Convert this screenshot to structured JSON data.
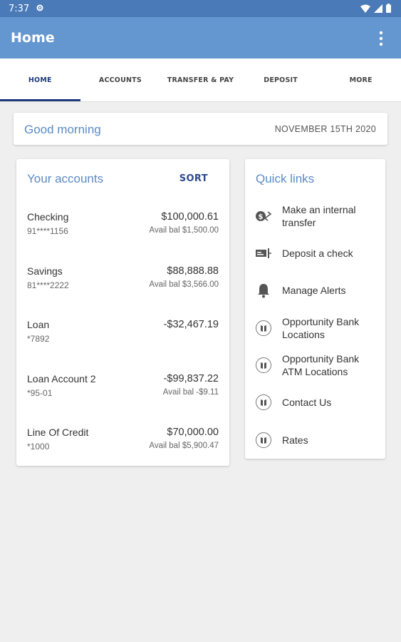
{
  "status_bar": {
    "time": "7:37"
  },
  "app_bar": {
    "title": "Home"
  },
  "tabs": [
    {
      "label": "HOME",
      "active": true
    },
    {
      "label": "ACCOUNTS",
      "active": false
    },
    {
      "label": "TRANSFER & PAY",
      "active": false
    },
    {
      "label": "DEPOSIT",
      "active": false
    },
    {
      "label": "MORE",
      "active": false
    }
  ],
  "greeting": {
    "text": "Good morning",
    "date": "NOVEMBER 15TH 2020"
  },
  "accounts": {
    "title": "Your accounts",
    "sort_label": "SORT",
    "items": [
      {
        "name": "Checking",
        "number": "91****1156",
        "balance": "$100,000.61",
        "avail": "Avail bal $1,500.00"
      },
      {
        "name": "Savings",
        "number": "81****2222",
        "balance": "$88,888.88",
        "avail": "Avail bal $3,566.00"
      },
      {
        "name": "Loan",
        "number": "*7892",
        "balance": "-$32,467.19",
        "avail": ""
      },
      {
        "name": "Loan Account 2",
        "number": "*95-01",
        "balance": "-$99,837.22",
        "avail": "Avail bal -$9.11"
      },
      {
        "name": "Line Of Credit",
        "number": "*1000",
        "balance": "$70,000.00",
        "avail": "Avail bal $5,900.47"
      }
    ]
  },
  "quick_links": {
    "title": "Quick links",
    "items": [
      {
        "label_lines": [
          "Make an internal",
          "transfer"
        ],
        "icon": "transfer-icon"
      },
      {
        "label_lines": [
          "Deposit a check"
        ],
        "icon": "check-deposit-icon"
      },
      {
        "label_lines": [
          "Manage Alerts"
        ],
        "icon": "bell-icon"
      },
      {
        "label_lines": [
          "Opportunity Bank",
          "Locations"
        ],
        "icon": "map-pin-icon"
      },
      {
        "label_lines": [
          "Opportunity Bank",
          "ATM Locations"
        ],
        "icon": "map-pin-icon"
      },
      {
        "label_lines": [
          "Contact Us"
        ],
        "icon": "map-pin-icon"
      },
      {
        "label_lines": [
          "Rates"
        ],
        "icon": "map-pin-icon"
      }
    ]
  },
  "colors": {
    "app_bar": "#6497cf",
    "status_bar": "#4a7ab8",
    "accent_text": "#5b8ac4",
    "active_tab": "#1e3a7a"
  }
}
